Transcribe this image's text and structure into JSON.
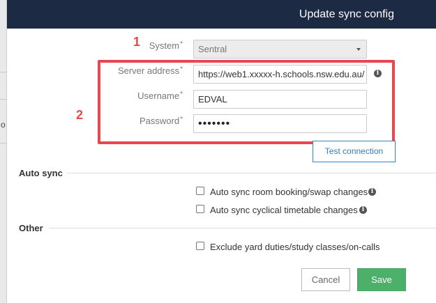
{
  "dialog": {
    "title": "Update sync config"
  },
  "backdrop": {
    "partial_text": "o"
  },
  "annotations": {
    "marker_1": "1",
    "marker_2": "2",
    "highlight_color": "#e9474f"
  },
  "form": {
    "system": {
      "label": "System",
      "required_mark": "*",
      "value": "Sentral"
    },
    "server_address": {
      "label": "Server address",
      "required_mark": "*",
      "value": "https://web1.xxxxx-h.schools.nsw.edu.au/"
    },
    "username": {
      "label": "Username",
      "required_mark": "*",
      "value": "EDVAL"
    },
    "password": {
      "label": "Password",
      "required_mark": "*",
      "value": "•••••••"
    },
    "test_connection_label": "Test connection"
  },
  "auto_sync": {
    "title": "Auto sync",
    "options": [
      {
        "label": "Auto sync room booking/swap changes",
        "checked": false
      },
      {
        "label": "Auto sync cyclical timetable changes",
        "checked": false
      }
    ]
  },
  "other": {
    "title": "Other",
    "options": [
      {
        "label": "Exclude yard duties/study classes/on-calls",
        "checked": false
      }
    ]
  },
  "footer": {
    "cancel_label": "Cancel",
    "save_label": "Save"
  },
  "colors": {
    "header_bg": "#1d2a44",
    "save_bg": "#4caf6a",
    "link_blue": "#2e7fbf",
    "required": "#d9534f"
  },
  "icons": {
    "info": "info-icon",
    "caret": "chevron-down-icon",
    "cursor": "mouse-pointer-icon"
  }
}
